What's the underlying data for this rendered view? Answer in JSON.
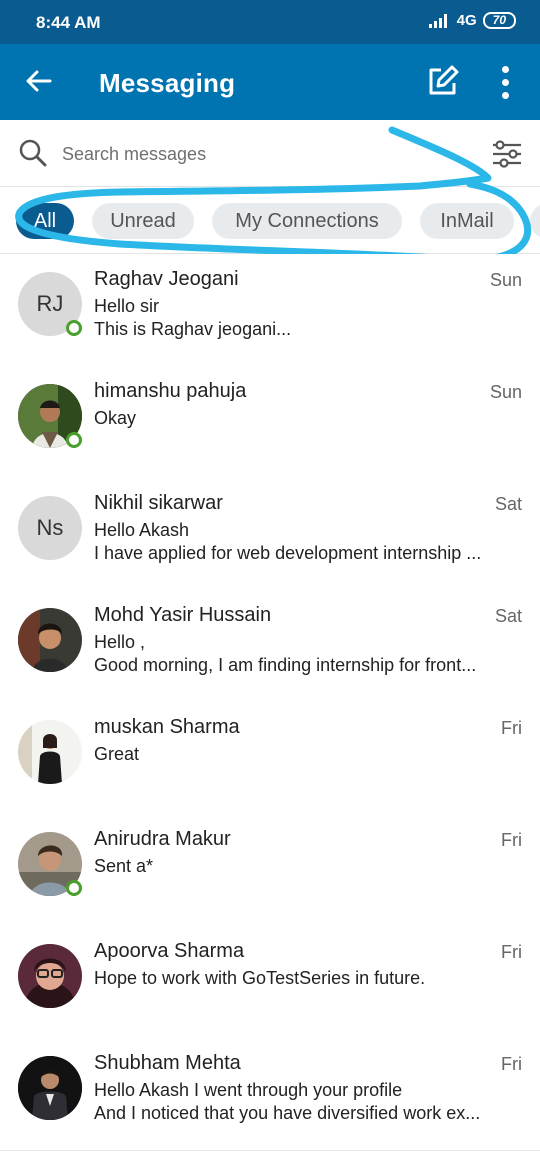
{
  "status_bar": {
    "time": "8:44 AM",
    "network": "4G",
    "battery": "70"
  },
  "app_bar": {
    "title": "Messaging",
    "back_icon": "arrow-left-icon",
    "compose_icon": "compose-icon",
    "more_icon": "more-vertical-icon",
    "background": "#0073b1",
    "status_bg": "#0a5b90"
  },
  "search": {
    "placeholder": "Search messages",
    "icon": "search-icon",
    "filter_icon": "filter-sliders-icon"
  },
  "filters": [
    {
      "label": "All",
      "active": true
    },
    {
      "label": "Unread",
      "active": false
    },
    {
      "label": "My Connections",
      "active": false
    },
    {
      "label": "InMail",
      "active": false
    }
  ],
  "conversations": [
    {
      "name": "Raghav Jeogani",
      "initials": "RJ",
      "date": "Sun",
      "line1": "Hello sir",
      "line2": "This is Raghav jeogani...",
      "online": true
    },
    {
      "name": "himanshu pahuja",
      "initials": "",
      "date": "Sun",
      "line1": "Okay",
      "line2": "",
      "online": true
    },
    {
      "name": "Nikhil sikarwar",
      "initials": "Ns",
      "date": "Sat",
      "line1": "Hello Akash",
      "line2": "I have applied for web development internship ...",
      "online": false
    },
    {
      "name": "Mohd Yasir Hussain",
      "initials": "",
      "date": "Sat",
      "line1": "Hello ,",
      "line2": "Good morning, I am finding internship for front...",
      "online": false
    },
    {
      "name": "muskan Sharma",
      "initials": "",
      "date": "Fri",
      "line1": "Great",
      "line2": "",
      "online": false
    },
    {
      "name": "Anirudra Makur",
      "initials": "",
      "date": "Fri",
      "line1": "Sent a*",
      "line2": "",
      "online": true
    },
    {
      "name": "Apoorva Sharma",
      "initials": "",
      "date": "Fri",
      "line1": "Hope to work with GoTestSeries in future.",
      "line2": "",
      "online": false
    },
    {
      "name": "Shubham Mehta",
      "initials": "",
      "date": "Fri",
      "line1": "Hello Akash I went through your profile",
      "line2": "And I noticed that you have diversified work ex...",
      "online": false
    }
  ]
}
